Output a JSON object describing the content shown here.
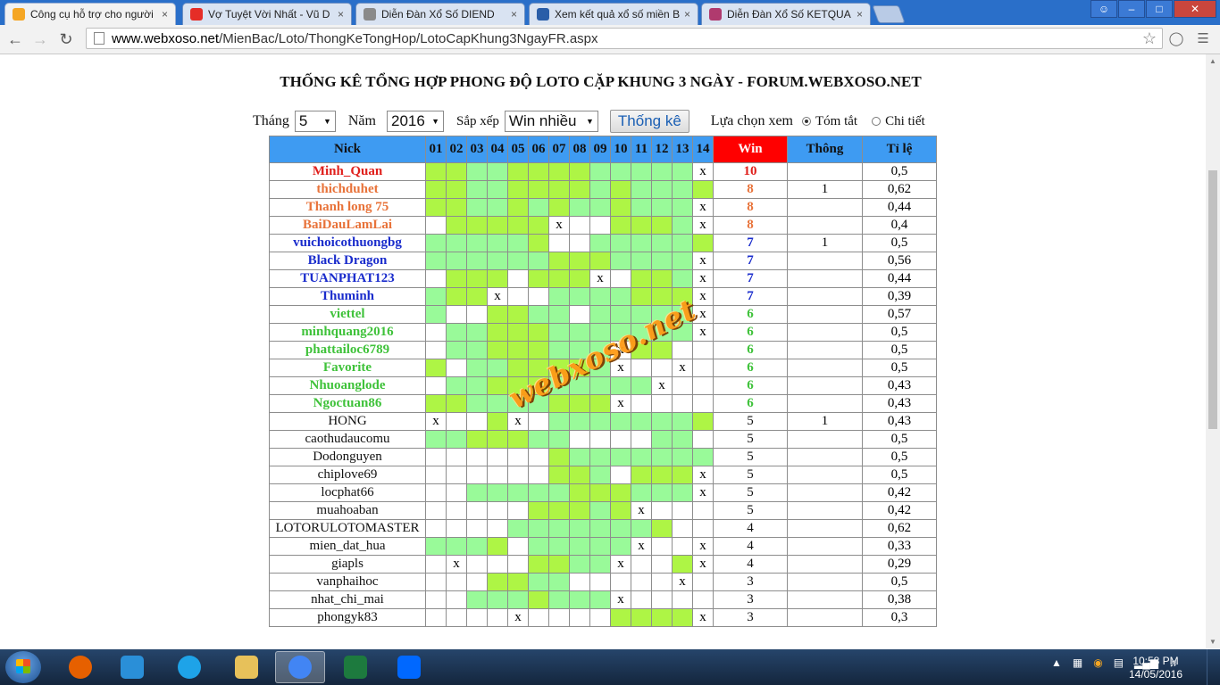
{
  "browser": {
    "tabs": [
      {
        "label": "Công cụ hỗ trợ cho người",
        "icon": "xs-icon",
        "color": "#f5a623",
        "active": true
      },
      {
        "label": "Vợ Tuyệt Vời Nhất - Vũ D",
        "icon": "youtube-icon",
        "color": "#e52d27"
      },
      {
        "label": "Diễn Đàn Xổ Số DIEND",
        "icon": "page-icon",
        "color": "#8a8a8a"
      },
      {
        "label": "Xem kết quả xổ số miền B",
        "icon": "kqbk-icon",
        "color": "#2a5ea8"
      },
      {
        "label": "Diễn Đàn Xổ Số KETQUA",
        "icon": "forum-icon",
        "color": "#b03a6e"
      }
    ],
    "url_host": "www.webxoso.net",
    "url_path": "/MienBac/Loto/ThongKeTongHop/LotoCapKhung3NgayFR.aspx"
  },
  "page": {
    "title": "THỐNG KÊ TỔNG HỢP PHONG ĐỘ LOTO CẶP KHUNG 3 NGÀY - FORUM.WEBXOSO.NET",
    "filters": {
      "month_label": "Tháng",
      "month_value": "5",
      "year_label": "Năm",
      "year_value": "2016",
      "sort_label": "Sắp xếp",
      "sort_value": "Win nhiều",
      "submit_label": "Thống kê",
      "view_label": "Lựa chọn xem",
      "view_options": [
        "Tóm tắt",
        "Chi tiết"
      ],
      "view_selected": "Tóm tắt"
    },
    "watermark": "webxoso.net"
  },
  "table": {
    "headers": {
      "nick": "Nick",
      "days": [
        "01",
        "02",
        "03",
        "04",
        "05",
        "06",
        "07",
        "08",
        "09",
        "10",
        "11",
        "12",
        "13",
        "14"
      ],
      "win": "Win",
      "thong": "Thông",
      "tile": "Tỉ lệ"
    },
    "colors": {
      "g1": "#aef545",
      "g2": "#99fa99",
      "red": "#e0201c",
      "orange": "#e8733a",
      "blue": "#1a2ccc",
      "green": "#3fc23a",
      "plain": "#111111"
    },
    "rows": [
      {
        "nick": "Minh_Quan",
        "color": "red",
        "cells": [
          "g1",
          "g1",
          "g2",
          "g2",
          "g1",
          "g1",
          "g1",
          "g1",
          "g2",
          "g2",
          "g2",
          "g2",
          "g2",
          "x"
        ],
        "win": "10",
        "thong": "",
        "tile": "0,5"
      },
      {
        "nick": "thichduhet",
        "color": "orange",
        "cells": [
          "g1",
          "g1",
          "g2",
          "g2",
          "g1",
          "g1",
          "g1",
          "g1",
          "g2",
          "g1",
          "g2",
          "g2",
          "g2",
          "g1"
        ],
        "win": "8",
        "thong": "1",
        "tile": "0,62"
      },
      {
        "nick": "Thanh long 75",
        "color": "orange",
        "cells": [
          "g1",
          "g1",
          "g2",
          "g2",
          "g1",
          "g2",
          "g1",
          "g2",
          "g2",
          "g1",
          "g2",
          "g2",
          "g2",
          "x"
        ],
        "win": "8",
        "thong": "",
        "tile": "0,44"
      },
      {
        "nick": "BaiDauLamLai",
        "color": "orange",
        "cells": [
          "w",
          "g1",
          "g1",
          "g1",
          "g1",
          "g1",
          "x",
          "w",
          "w",
          "g1",
          "g1",
          "g1",
          "g2",
          "x"
        ],
        "win": "8",
        "thong": "",
        "tile": "0,4"
      },
      {
        "nick": "vuichoicothuongbg",
        "color": "blue",
        "cells": [
          "g2",
          "g2",
          "g2",
          "g2",
          "g2",
          "g1",
          "w",
          "w",
          "g2",
          "g2",
          "g2",
          "g2",
          "g2",
          "g1"
        ],
        "win": "7",
        "thong": "1",
        "tile": "0,5"
      },
      {
        "nick": "Black Dragon",
        "color": "blue",
        "cells": [
          "g2",
          "g2",
          "g2",
          "g2",
          "g2",
          "g2",
          "g1",
          "g1",
          "g1",
          "g2",
          "g2",
          "g2",
          "g2",
          "x"
        ],
        "win": "7",
        "thong": "",
        "tile": "0,56"
      },
      {
        "nick": "TUANPHAT123",
        "color": "blue",
        "cells": [
          "w",
          "g1",
          "g1",
          "g1",
          "w",
          "g1",
          "g1",
          "g1",
          "x",
          "w",
          "g1",
          "g1",
          "g2",
          "x"
        ],
        "win": "7",
        "thong": "",
        "tile": "0,44"
      },
      {
        "nick": "Thuminh",
        "color": "blue",
        "cells": [
          "g2",
          "g1",
          "g1",
          "x",
          "w",
          "w",
          "g2",
          "g2",
          "g2",
          "g2",
          "g1",
          "g1",
          "g1",
          "x"
        ],
        "win": "7",
        "thong": "",
        "tile": "0,39"
      },
      {
        "nick": "viettel",
        "color": "green",
        "cells": [
          "g2",
          "w",
          "w",
          "g1",
          "g1",
          "g2",
          "g2",
          "w",
          "g2",
          "g2",
          "g2",
          "g2",
          "g2",
          "x"
        ],
        "win": "6",
        "thong": "",
        "tile": "0,57"
      },
      {
        "nick": "minhquang2016",
        "color": "green",
        "cells": [
          "w",
          "g2",
          "g2",
          "g1",
          "g1",
          "g1",
          "g2",
          "g2",
          "g2",
          "g2",
          "g2",
          "g2",
          "g2",
          "x"
        ],
        "win": "6",
        "thong": "",
        "tile": "0,5"
      },
      {
        "nick": "phattailoc6789",
        "color": "green",
        "cells": [
          "w",
          "g2",
          "g2",
          "g1",
          "g1",
          "g1",
          "g2",
          "g2",
          "g2",
          "x",
          "g1",
          "g1",
          "w",
          "w"
        ],
        "win": "6",
        "thong": "",
        "tile": "0,5"
      },
      {
        "nick": "Favorite",
        "color": "green",
        "cells": [
          "g1",
          "w",
          "g2",
          "g2",
          "g1",
          "g1",
          "g1",
          "g1",
          "g2",
          "x",
          "w",
          "w",
          "x",
          "w"
        ],
        "win": "6",
        "thong": "",
        "tile": "0,5"
      },
      {
        "nick": "Nhuoanglode",
        "color": "green",
        "cells": [
          "w",
          "g2",
          "g2",
          "g1",
          "g1",
          "g1",
          "g2",
          "g2",
          "g2",
          "g2",
          "g2",
          "x",
          "w",
          "w"
        ],
        "win": "6",
        "thong": "",
        "tile": "0,43"
      },
      {
        "nick": "Ngoctuan86",
        "color": "green",
        "cells": [
          "g1",
          "g1",
          "g2",
          "g2",
          "g2",
          "g2",
          "g1",
          "g1",
          "g1",
          "x",
          "w",
          "w",
          "w",
          "w"
        ],
        "win": "6",
        "thong": "",
        "tile": "0,43"
      },
      {
        "nick": "HONG",
        "color": "plain",
        "cells": [
          "x",
          "w",
          "w",
          "g1",
          "x",
          "w",
          "g2",
          "g2",
          "g2",
          "g2",
          "g2",
          "g2",
          "g2",
          "g1"
        ],
        "win": "5",
        "thong": "1",
        "tile": "0,43"
      },
      {
        "nick": "caothudaucomu",
        "color": "plain",
        "cells": [
          "g2",
          "g2",
          "g1",
          "g1",
          "g1",
          "g2",
          "g2",
          "w",
          "w",
          "w",
          "w",
          "g2",
          "g2",
          "w"
        ],
        "win": "5",
        "thong": "",
        "tile": "0,5"
      },
      {
        "nick": "Dodonguyen",
        "color": "plain",
        "cells": [
          "w",
          "w",
          "w",
          "w",
          "w",
          "w",
          "g1",
          "g2",
          "g2",
          "g2",
          "g2",
          "g2",
          "g2",
          "g2"
        ],
        "win": "5",
        "thong": "",
        "tile": "0,5"
      },
      {
        "nick": "chiplove69",
        "color": "plain",
        "cells": [
          "w",
          "w",
          "w",
          "w",
          "w",
          "w",
          "g1",
          "g1",
          "g2",
          "w",
          "g1",
          "g1",
          "g1",
          "x"
        ],
        "win": "5",
        "thong": "",
        "tile": "0,5"
      },
      {
        "nick": "locphat66",
        "color": "plain",
        "cells": [
          "w",
          "w",
          "g2",
          "g2",
          "g2",
          "g2",
          "g2",
          "g1",
          "g1",
          "g1",
          "g2",
          "g2",
          "g2",
          "x"
        ],
        "win": "5",
        "thong": "",
        "tile": "0,42"
      },
      {
        "nick": "muahoaban",
        "color": "plain",
        "cells": [
          "w",
          "w",
          "w",
          "w",
          "w",
          "g1",
          "g1",
          "g1",
          "g2",
          "g1",
          "x",
          "w",
          "w",
          "w"
        ],
        "win": "5",
        "thong": "",
        "tile": "0,42"
      },
      {
        "nick": "LOTORULOTOMASTER",
        "color": "plain",
        "cells": [
          "w",
          "w",
          "w",
          "w",
          "g2",
          "g2",
          "g2",
          "g2",
          "g2",
          "g2",
          "g2",
          "g1",
          "w",
          "w"
        ],
        "win": "4",
        "thong": "",
        "tile": "0,62"
      },
      {
        "nick": "mien_dat_hua",
        "color": "plain",
        "cells": [
          "g2",
          "g2",
          "g2",
          "g1",
          "w",
          "g2",
          "g2",
          "g2",
          "g2",
          "g2",
          "x",
          "w",
          "w",
          "x"
        ],
        "win": "4",
        "thong": "",
        "tile": "0,33"
      },
      {
        "nick": "giapls",
        "color": "plain",
        "cells": [
          "w",
          "x",
          "w",
          "w",
          "w",
          "g1",
          "g1",
          "g2",
          "g2",
          "x",
          "w",
          "w",
          "g1",
          "x"
        ],
        "win": "4",
        "thong": "",
        "tile": "0,29"
      },
      {
        "nick": "vanphaihoc",
        "color": "plain",
        "cells": [
          "w",
          "w",
          "w",
          "g1",
          "g1",
          "g2",
          "g2",
          "w",
          "w",
          "w",
          "w",
          "w",
          "x",
          "w"
        ],
        "win": "3",
        "thong": "",
        "tile": "0,5"
      },
      {
        "nick": "nhat_chi_mai",
        "color": "plain",
        "cells": [
          "w",
          "w",
          "g2",
          "g2",
          "g2",
          "g1",
          "g2",
          "g2",
          "g2",
          "x",
          "w",
          "w",
          "w",
          "w"
        ],
        "win": "3",
        "thong": "",
        "tile": "0,38"
      },
      {
        "nick": "phongyk83",
        "color": "plain",
        "cells": [
          "w",
          "w",
          "w",
          "w",
          "x",
          "w",
          "w",
          "w",
          "w",
          "g1",
          "g1",
          "g1",
          "g1",
          "x"
        ],
        "win": "3",
        "thong": "",
        "tile": "0,3"
      }
    ]
  },
  "taskbar": {
    "apps": [
      {
        "name": "firefox-icon",
        "color": "#e66000"
      },
      {
        "name": "media-player-icon",
        "color": "#2a8fd8"
      },
      {
        "name": "ie-icon",
        "color": "#1ea3e8"
      },
      {
        "name": "explorer-icon",
        "color": "#e7c15a"
      },
      {
        "name": "chrome-icon",
        "color": "#4285f4",
        "active": true
      },
      {
        "name": "excel-icon",
        "color": "#1d7a3e"
      },
      {
        "name": "zalo-icon",
        "color": "#0068ff"
      }
    ],
    "time": "10:58 PM",
    "date": "14/05/2016"
  }
}
